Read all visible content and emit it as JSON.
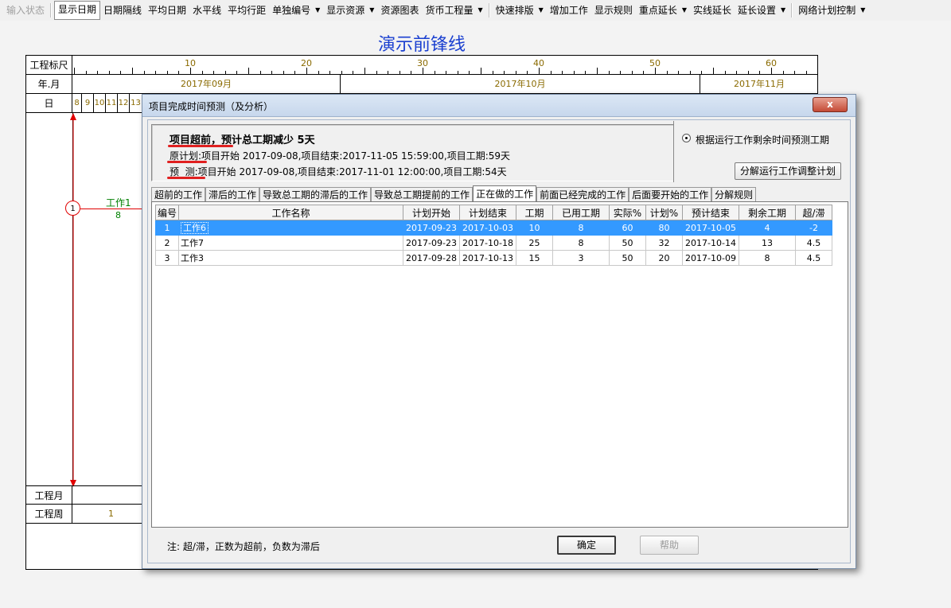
{
  "toolbar": {
    "items": [
      {
        "label": "输入状态",
        "state": "disabled"
      },
      {
        "label": "显示日期",
        "state": "pressed"
      },
      {
        "label": "日期隔线",
        "state": "normal"
      },
      {
        "label": "平均日期",
        "state": "normal"
      },
      {
        "label": "水平线",
        "state": "normal"
      },
      {
        "label": "平均行距",
        "state": "normal"
      },
      {
        "label": "单独编号",
        "state": "normal",
        "dropdown": true
      },
      {
        "label": "显示资源",
        "state": "normal",
        "dropdown": true
      },
      {
        "label": "资源图表",
        "state": "normal"
      },
      {
        "label": "货币工程量",
        "state": "normal",
        "dropdown": true
      },
      {
        "label": "快速排版",
        "state": "normal",
        "dropdown": true
      },
      {
        "label": "增加工作",
        "state": "normal"
      },
      {
        "label": "显示规则",
        "state": "normal"
      },
      {
        "label": "重点延长",
        "state": "normal",
        "dropdown": true
      },
      {
        "label": "实线延长",
        "state": "normal"
      },
      {
        "label": "延长设置",
        "state": "normal",
        "dropdown": true
      },
      {
        "label": "网络计划控制",
        "state": "normal",
        "dropdown": true
      }
    ]
  },
  "chart": {
    "title": "演示前锋线",
    "rows": {
      "ruler": "工程标尺",
      "year_month": "年.月",
      "day": "日",
      "project_month": "工程月",
      "project_week": "工程周"
    },
    "ruler_ticks": [
      "10",
      "20",
      "30",
      "40",
      "50",
      "60"
    ],
    "months": [
      "2017年09月",
      "2017年10月",
      "2017年11月"
    ],
    "days": [
      "8",
      "9",
      "10",
      "11",
      "12",
      "13"
    ],
    "week_value": "1",
    "task": {
      "node_number": "1",
      "name": "工作1",
      "duration": "8"
    },
    "colors": {
      "line": "#e00000",
      "task": "#008000",
      "title": "#1a3fd0"
    }
  },
  "dialog": {
    "title": "项目完成时间预测（及分析）",
    "close_label": "x",
    "summary": {
      "headline": "项目超前，预计总工期减少 5天",
      "original_label": "原计划",
      "original_text": ":项目开始 2017-09-08,项目结束:2017-11-05 15:59:00,项目工期:59天",
      "forecast_label": "预  测",
      "forecast_text": ":项目开始 2017-09-08,项目结束:2017-11-01 12:00:00,项目工期:54天"
    },
    "option": {
      "radio_label": "根据运行工作剩余时间预测工期",
      "radio_checked": true,
      "decompose_button": "分解运行工作调整计划"
    },
    "tabs": [
      {
        "label": "超前的工作",
        "active": false
      },
      {
        "label": "滞后的工作",
        "active": false
      },
      {
        "label": "导致总工期的滞后的工作",
        "active": false
      },
      {
        "label": "导致总工期提前的工作",
        "active": false
      },
      {
        "label": "正在做的工作",
        "active": true
      },
      {
        "label": "前面已经完成的工作",
        "active": false
      },
      {
        "label": "后面要开始的工作",
        "active": false
      },
      {
        "label": "分解规则",
        "active": false
      }
    ],
    "table": {
      "columns": [
        "编号",
        "工作名称",
        "计划开始",
        "计划结束",
        "工期",
        "已用工期",
        "实际%",
        "计划%",
        "预计结束",
        "剩余工期",
        "超/滞"
      ],
      "rows": [
        {
          "selected": true,
          "cells": [
            "1",
            "工作6",
            "2017-09-23",
            "2017-10-03",
            "10",
            "8",
            "60",
            "80",
            "2017-10-05",
            "4",
            "-2"
          ]
        },
        {
          "selected": false,
          "cells": [
            "2",
            "工作7",
            "2017-09-23",
            "2017-10-18",
            "25",
            "8",
            "50",
            "32",
            "2017-10-14",
            "13",
            "4.5"
          ]
        },
        {
          "selected": false,
          "cells": [
            "3",
            "工作3",
            "2017-09-28",
            "2017-10-13",
            "15",
            "3",
            "50",
            "20",
            "2017-10-09",
            "8",
            "4.5"
          ]
        }
      ]
    },
    "note": "注: 超/滞，正数为超前，负数为滞后",
    "ok_button": "确定",
    "help_button": "帮助"
  }
}
